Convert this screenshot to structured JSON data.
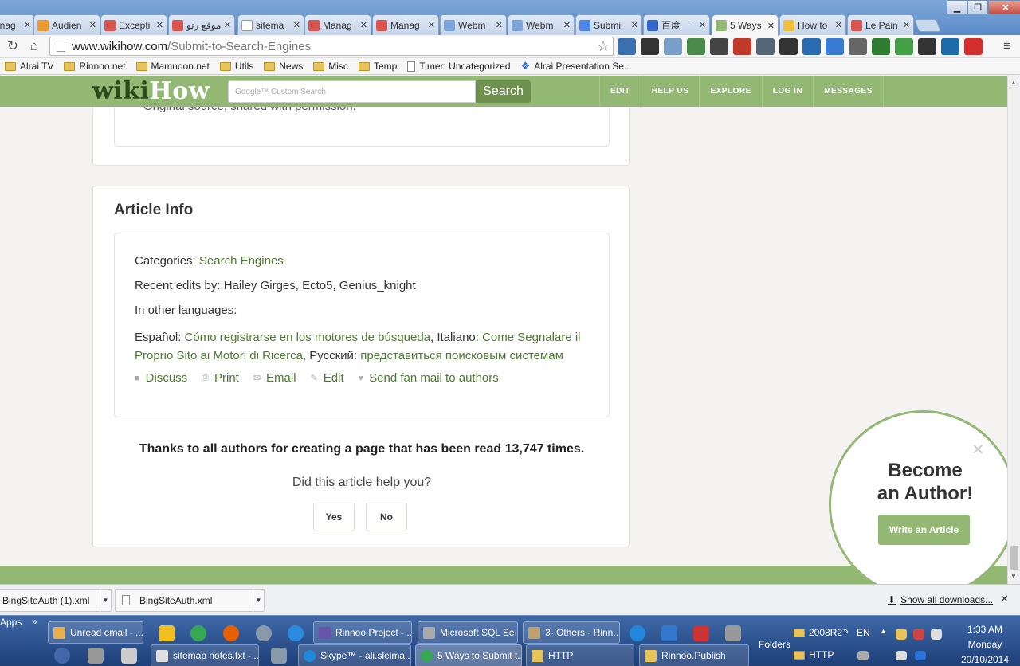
{
  "browser": {
    "tabs": [
      {
        "label": "Manag",
        "color": "#d9534f"
      },
      {
        "label": "Audien",
        "color": "#e99b2f"
      },
      {
        "label": "Excepti",
        "color": "#d9534f"
      },
      {
        "label": "موقع رنو",
        "color": "#d9534f"
      },
      {
        "label": "sitema",
        "color": "#ffffff"
      },
      {
        "label": "Manag",
        "color": "#d9534f"
      },
      {
        "label": "Manag",
        "color": "#d9534f"
      },
      {
        "label": "Webm",
        "color": "#7da4d8"
      },
      {
        "label": "Webm",
        "color": "#7da4d8"
      },
      {
        "label": "Submi",
        "color": "#4a86e8"
      },
      {
        "label": "百度一",
        "color": "#3366cc"
      },
      {
        "label": "5 Ways",
        "color": "#93b874",
        "active": true
      },
      {
        "label": "How to",
        "color": "#f0c040"
      },
      {
        "label": "Le Pain",
        "color": "#d9534f"
      }
    ],
    "url_host": "www.wikihow.com",
    "url_path": "/Submit-to-Search-Engines",
    "bookmarks": [
      {
        "label": "Alrai TV",
        "type": "folder"
      },
      {
        "label": "Rinnoo.net",
        "type": "folder"
      },
      {
        "label": "Mamnoon.net",
        "type": "folder"
      },
      {
        "label": "Utils",
        "type": "folder"
      },
      {
        "label": "News",
        "type": "folder"
      },
      {
        "label": "Misc",
        "type": "folder"
      },
      {
        "label": "Temp",
        "type": "folder"
      },
      {
        "label": "Timer: Uncategorized",
        "type": "page"
      },
      {
        "label": "Alrai Presentation Se...",
        "type": "dropbox"
      }
    ],
    "extensions": [
      "#3a6fb0",
      "#333333",
      "#7aa0c8",
      "#4a8a4a",
      "#444444",
      "#c0392b",
      "#556677",
      "#333333",
      "#2b6cb0",
      "#3a7bd5",
      "#666666",
      "#2e7d32",
      "#43a047",
      "#333333",
      "#1b6ca8",
      "#d32f2f"
    ]
  },
  "site": {
    "logo_wiki": "wiki",
    "logo_how": "How",
    "search_placeholder": "Google™ Custom Search",
    "search_button": "Search",
    "nav": [
      "EDIT",
      "HELP US",
      "EXPLORE",
      "LOG IN",
      "MESSAGES"
    ]
  },
  "prev_card": {
    "caption": "Original source, shared with permission."
  },
  "article_info": {
    "title": "Article Info",
    "categories_label": "Categories:",
    "category": "Search Engines",
    "recent_edits": "Recent edits by: Hailey Girges, Ecto5, Genius_knight",
    "other_languages": "In other languages:",
    "es_label": "Español:",
    "es_link": "Cómo registrarse en los motores de búsqueda",
    "it_label": ", Italiano:",
    "it_link": "Come Segnalare il Proprio Sito ai Motori di Ricerca",
    "ru_label": ", Русский:",
    "ru_link": "представиться поисковым системам",
    "actions": {
      "discuss": "Discuss",
      "print": "Print",
      "email": "Email",
      "edit": "Edit",
      "fanmail": "Send fan mail to authors"
    },
    "thanks": "Thanks to all authors for creating a page that has been read 13,747 times.",
    "helped_question": "Did this article help you?",
    "yes": "Yes",
    "no": "No"
  },
  "author_popup": {
    "title_line1": "Become",
    "title_line2": "an Author!",
    "button": "Write an Article"
  },
  "downloads": {
    "items": [
      "BingSiteAuth (1).xml",
      "BingSiteAuth.xml"
    ],
    "show_all": "Show all downloads..."
  },
  "taskbar": {
    "apps_label": "Apps",
    "row1": [
      "Unread email - ...",
      "Rinnoo.Project - ...",
      "Microsoft SQL Se...",
      "3- Others - Rinn..."
    ],
    "row2": [
      "sitemap notes.txt - ...",
      "Skype™ - ali.sleima...",
      "5 Ways to Submit t...",
      "HTTP",
      "Rinnoo.Publish"
    ],
    "folders_label": "Folders",
    "folder1": "2008R2",
    "folder2": "HTTP",
    "lang": "EN",
    "time": "1:33 AM",
    "day": "Monday",
    "date": "20/10/2014"
  }
}
